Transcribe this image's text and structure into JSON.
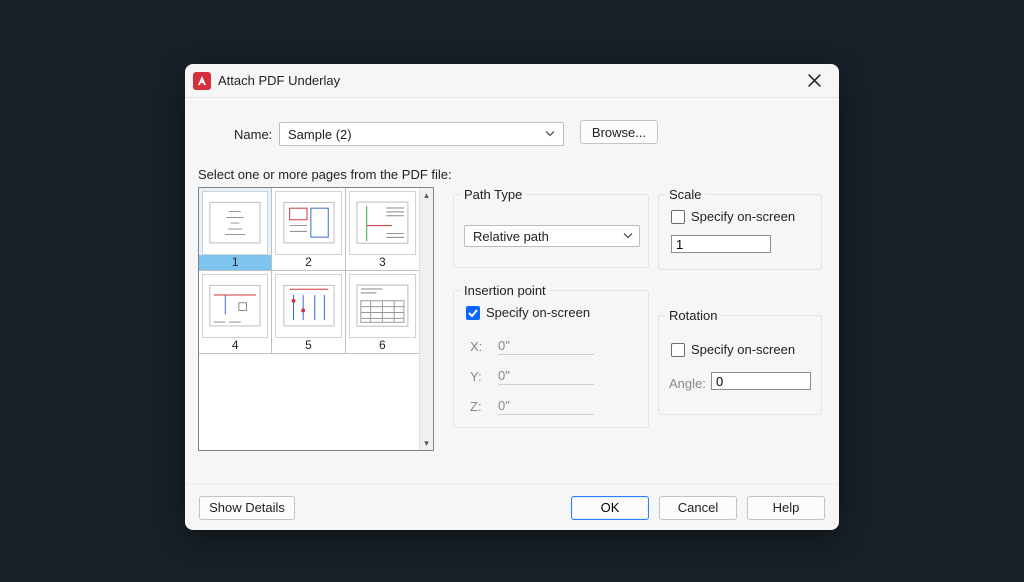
{
  "title": "Attach PDF Underlay",
  "name": {
    "label": "Name:",
    "value": "Sample (2)",
    "browse": "Browse..."
  },
  "selectPagesLabel": "Select one or more pages from the PDF file:",
  "thumbs": [
    "1",
    "2",
    "3",
    "4",
    "5",
    "6"
  ],
  "path": {
    "title": "Path Type",
    "value": "Relative path"
  },
  "scale": {
    "title": "Scale",
    "specify": "Specify on-screen",
    "value": "1"
  },
  "insertion": {
    "title": "Insertion point",
    "specify": "Specify on-screen",
    "x": {
      "label": "X:",
      "value": "0\""
    },
    "y": {
      "label": "Y:",
      "value": "0\""
    },
    "z": {
      "label": "Z:",
      "value": "0\""
    }
  },
  "rotation": {
    "title": "Rotation",
    "specify": "Specify on-screen",
    "angleLabel": "Angle:",
    "value": "0"
  },
  "buttons": {
    "show": "Show Details",
    "ok": "OK",
    "cancel": "Cancel",
    "help": "Help"
  }
}
